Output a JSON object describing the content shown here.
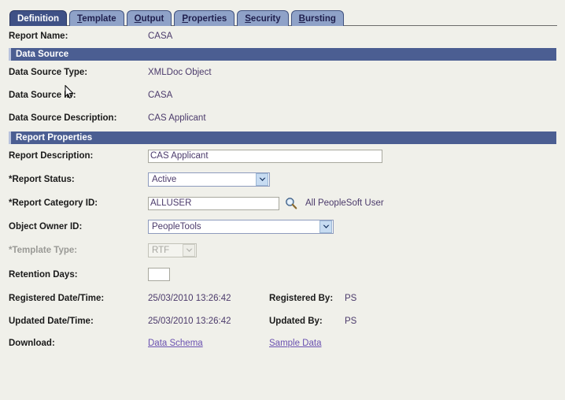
{
  "tabs": [
    {
      "label": "Definition",
      "accel": "",
      "active": true
    },
    {
      "label": "Template",
      "accel": "T",
      "active": false
    },
    {
      "label": "Output",
      "accel": "O",
      "active": false
    },
    {
      "label": "Properties",
      "accel": "P",
      "active": false
    },
    {
      "label": "Security",
      "accel": "S",
      "active": false
    },
    {
      "label": "Bursting",
      "accel": "B",
      "active": false
    }
  ],
  "report_name": {
    "label": "Report Name:",
    "value": "CASA"
  },
  "data_source": {
    "section_title": "Data Source",
    "type_label": "Data Source Type:",
    "type_value": "XMLDoc Object",
    "id_label": "Data Source ID:",
    "id_value": "CASA",
    "description_label": "Data Source Description:",
    "description_value": "CAS Applicant"
  },
  "report_properties": {
    "section_title": "Report Properties",
    "description_label": "Report Description:",
    "description_value": "CAS Applicant",
    "status_label": "*Report Status:",
    "status_value": "Active",
    "category_label": "*Report Category ID:",
    "category_value": "ALLUSER",
    "category_description": "All PeopleSoft User",
    "owner_label": "Object Owner ID:",
    "owner_value": "PeopleTools",
    "template_type_label": "*Template Type:",
    "template_type_value": "RTF",
    "retention_label": "Retention Days:",
    "retention_value": "",
    "registered_datetime_label": "Registered Date/Time:",
    "registered_datetime_value": "25/03/2010 13:26:42",
    "registered_by_label": "Registered By:",
    "registered_by_value": "PS",
    "updated_datetime_label": "Updated Date/Time:",
    "updated_datetime_value": "25/03/2010 13:26:42",
    "updated_by_label": "Updated By:",
    "updated_by_value": "PS",
    "download_label": "Download:",
    "download_links": [
      {
        "label": "Data Schema"
      },
      {
        "label": "Sample Data"
      }
    ]
  },
  "icons": {
    "lookup": "magnifier-icon",
    "dropdown": "chevron-down-icon",
    "pointer": "mouse-pointer-icon"
  },
  "colors": {
    "tab_active_bg": "#3f5186",
    "tab_inactive_bg": "#8fa2c8",
    "section_bar_bg": "#4b5e92",
    "page_bg": "#f0f0ea",
    "value_text": "#4b3a6b",
    "link": "#6a51b0"
  }
}
